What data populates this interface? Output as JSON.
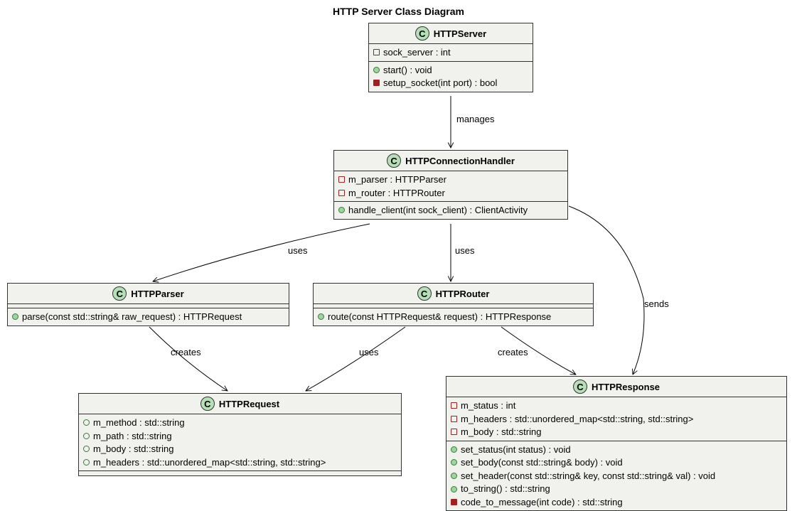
{
  "title": "HTTP Server Class Diagram",
  "classes": {
    "httpserver": {
      "name": "HTTPServer",
      "fields": [
        {
          "vis": "private-sq",
          "text": "sock_server : int"
        }
      ],
      "methods": [
        {
          "vis": "public-circle",
          "text": "start() : void"
        },
        {
          "vis": "private-fill",
          "text": "setup_socket(int port) : bool"
        }
      ]
    },
    "httpconnectionhandler": {
      "name": "HTTPConnectionHandler",
      "fields": [
        {
          "vis": "private-sq",
          "text": "m_parser : HTTPParser"
        },
        {
          "vis": "private-sq",
          "text": "m_router : HTTPRouter"
        }
      ],
      "methods": [
        {
          "vis": "public-circle",
          "text": "handle_client(int sock_client) : ClientActivity"
        }
      ]
    },
    "httpparser": {
      "name": "HTTPParser",
      "fields": [],
      "methods": [
        {
          "vis": "public-circle",
          "text": "parse(const std::string& raw_request) : HTTPRequest"
        }
      ]
    },
    "httprouter": {
      "name": "HTTPRouter",
      "fields": [],
      "methods": [
        {
          "vis": "public-circle",
          "text": "route(const HTTPRequest& request) : HTTPResponse"
        }
      ]
    },
    "httprequest": {
      "name": "HTTPRequest",
      "fields": [
        {
          "vis": "public-open",
          "text": "m_method : std::string"
        },
        {
          "vis": "public-open",
          "text": "m_path : std::string"
        },
        {
          "vis": "public-open",
          "text": "m_body : std::string"
        },
        {
          "vis": "public-open",
          "text": "m_headers : std::unordered_map<std::string, std::string>"
        }
      ],
      "methods": []
    },
    "httpresponse": {
      "name": "HTTPResponse",
      "fields": [
        {
          "vis": "private-sq",
          "text": "m_status : int"
        },
        {
          "vis": "private-sq",
          "text": "m_headers : std::unordered_map<std::string, std::string>"
        },
        {
          "vis": "private-sq",
          "text": "m_body : std::string"
        }
      ],
      "methods": [
        {
          "vis": "public-circle",
          "text": "set_status(int status) : void"
        },
        {
          "vis": "public-circle",
          "text": "set_body(const std::string& body) : void"
        },
        {
          "vis": "public-circle",
          "text": "set_header(const std::string& key, const std::string& val) : void"
        },
        {
          "vis": "public-circle",
          "text": "to_string() : std::string"
        },
        {
          "vis": "private-fill",
          "text": "code_to_message(int code) : std::string"
        }
      ]
    }
  },
  "edges": {
    "server_handler": "manages",
    "handler_parser": "uses",
    "handler_router": "uses",
    "handler_response": "sends",
    "parser_request": "creates",
    "router_request": "uses",
    "router_response": "creates"
  }
}
